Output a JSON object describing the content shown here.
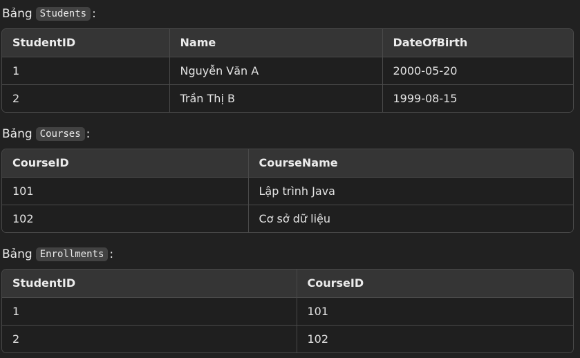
{
  "sections": [
    {
      "prefix": "Bảng",
      "table_name": "Students",
      "suffix": ":",
      "headers": [
        "StudentID",
        "Name",
        "DateOfBirth"
      ],
      "rows": [
        [
          "1",
          "Nguyễn Văn A",
          "2000-05-20"
        ],
        [
          "2",
          "Trần Thị B",
          "1999-08-15"
        ]
      ]
    },
    {
      "prefix": "Bảng",
      "table_name": "Courses",
      "suffix": ":",
      "headers": [
        "CourseID",
        "CourseName"
      ],
      "rows": [
        [
          "101",
          "Lập trình Java"
        ],
        [
          "102",
          "Cơ sở dữ liệu"
        ]
      ]
    },
    {
      "prefix": "Bảng",
      "table_name": "Enrollments",
      "suffix": ":",
      "headers": [
        "StudentID",
        "CourseID"
      ],
      "rows": [
        [
          "1",
          "101"
        ],
        [
          "2",
          "102"
        ]
      ]
    }
  ]
}
